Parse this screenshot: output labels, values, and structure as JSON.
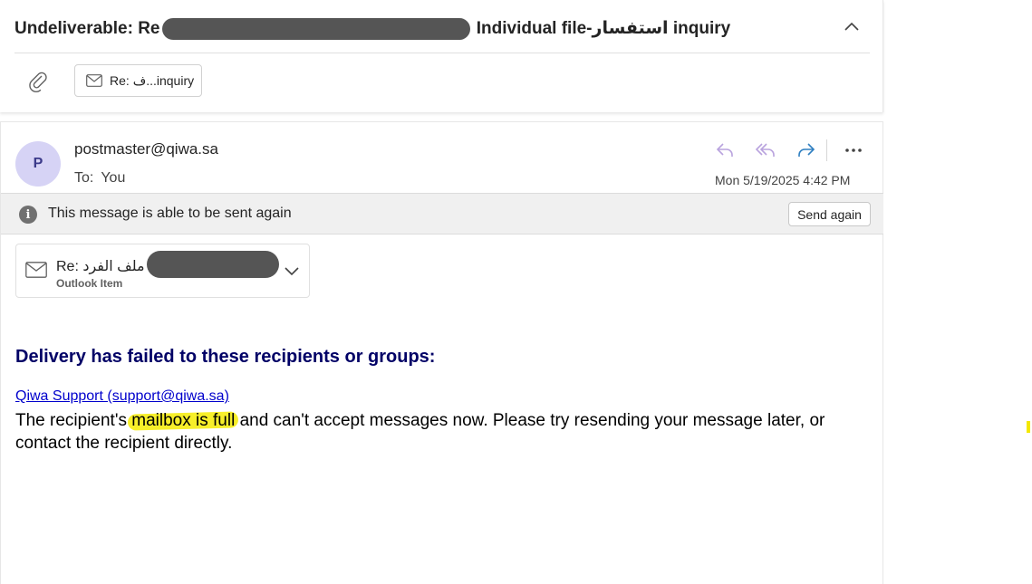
{
  "subject": {
    "prefix": "Undeliverable: Re",
    "suffix": " Individual file-استفسار inquiry"
  },
  "attachment": {
    "label": "Re: ف...inquiry"
  },
  "message": {
    "avatar_initial": "P",
    "sender": "postmaster@qiwa.sa",
    "to_label": "To:",
    "to_value": "You",
    "date": "Mon 5/19/2025 4:42 PM",
    "icons": [
      "reply-icon",
      "reply-all-icon",
      "forward-icon",
      "more-icon"
    ]
  },
  "info_bar": {
    "text": "This message is able to be sent again",
    "button": "Send again"
  },
  "outlook_item": {
    "title_prefix": "Re: ملف الفرد",
    "subtitle": "Outlook Item"
  },
  "body": {
    "heading": "Delivery has failed to these recipients or groups:",
    "recipient_link": "Qiwa Support (support@qiwa.sa)",
    "text_before": "The recipient's ",
    "highlighted": "mailbox is full",
    "text_after": " and can't accept messages now. Please try resending your message later, or contact the recipient directly."
  },
  "colors": {
    "avatar_bg": "#d6d3f5",
    "heading": "#000066",
    "link": "#0000cc",
    "highlight": "#f7ef2a",
    "forward_icon": "#2f7fc1",
    "reply_icon": "#b9a3de"
  }
}
